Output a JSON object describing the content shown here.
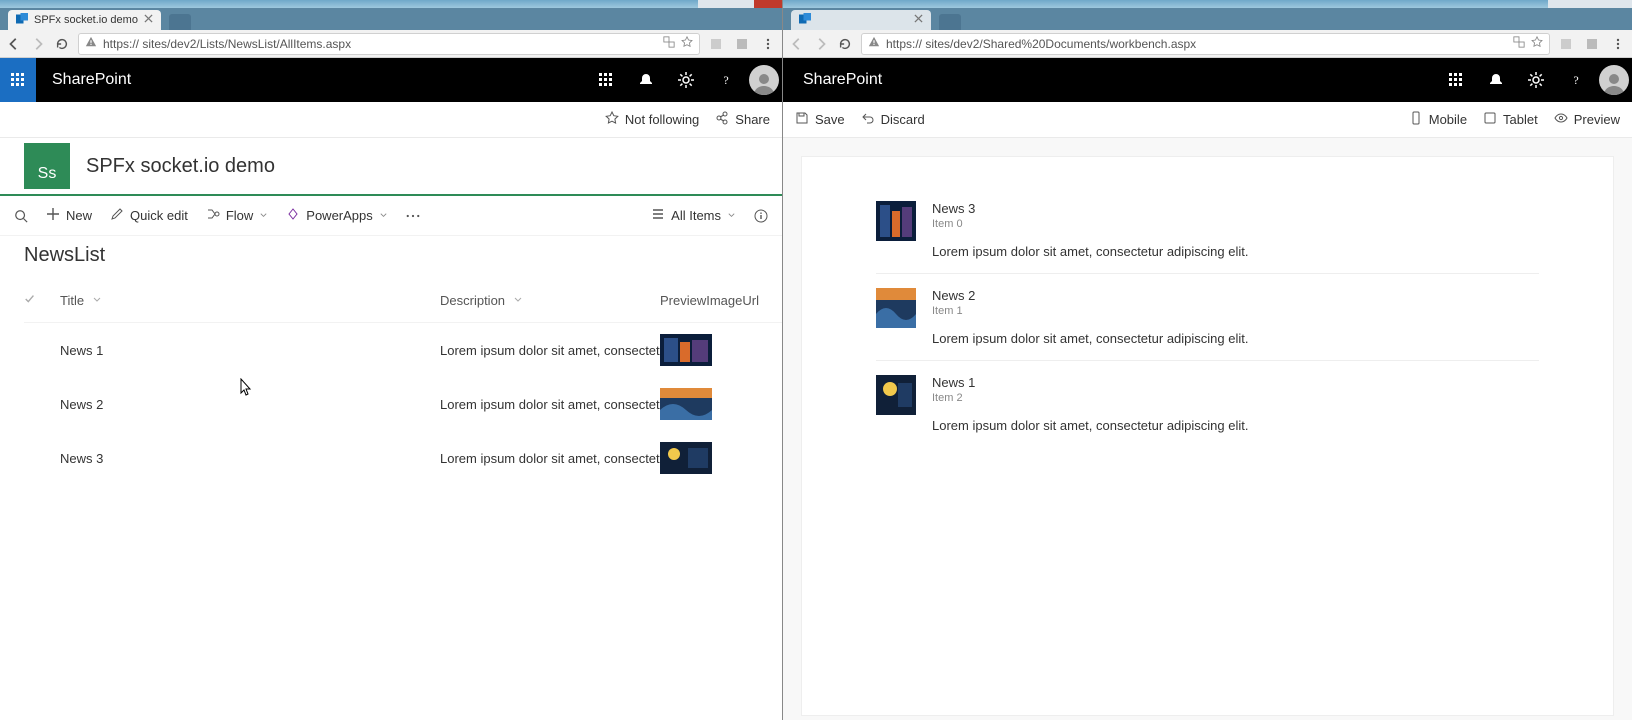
{
  "left_window": {
    "tab_title": "SPFx socket.io demo",
    "url_visible": "https://                 sites/dev2/Lists/NewsList/AllItems.aspx",
    "url_scheme": "https",
    "suite_brand": "SharePoint",
    "follow_label": "Not following",
    "share_label": "Share",
    "site_logo_text": "Ss",
    "site_title": "SPFx socket.io demo",
    "toolbar": {
      "new_label": "New",
      "quickedit_label": "Quick edit",
      "flow_label": "Flow",
      "powerapps_label": "PowerApps",
      "view_label": "All Items"
    },
    "list_name": "NewsList",
    "columns": {
      "title": "Title",
      "description": "Description",
      "preview": "PreviewImageUrl"
    },
    "rows": [
      {
        "title": "News 1",
        "description": "Lorem ipsum dolor sit amet, consectetur adipis"
      },
      {
        "title": "News 2",
        "description": "Lorem ipsum dolor sit amet, consectetur adipis"
      },
      {
        "title": "News 3",
        "description": "Lorem ipsum dolor sit amet, consectetur adipis"
      }
    ]
  },
  "right_window": {
    "url_visible": "https://                 sites/dev2/Shared%20Documents/workbench.aspx",
    "url_scheme": "https",
    "suite_brand": "SharePoint",
    "actionbar": {
      "save": "Save",
      "discard": "Discard",
      "mobile": "Mobile",
      "tablet": "Tablet",
      "preview": "Preview"
    },
    "cards": [
      {
        "title": "News 3",
        "meta": "Item 0",
        "desc": "Lorem ipsum dolor sit amet, consectetur adipiscing elit."
      },
      {
        "title": "News 2",
        "meta": "Item 1",
        "desc": "Lorem ipsum dolor sit amet, consectetur adipiscing elit."
      },
      {
        "title": "News 1",
        "meta": "Item 2",
        "desc": "Lorem ipsum dolor sit amet, consectetur adipiscing elit."
      }
    ]
  }
}
